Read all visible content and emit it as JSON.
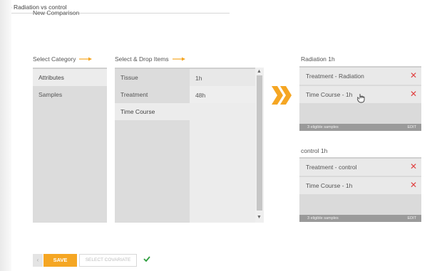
{
  "comparison": {
    "title": "New Comparison",
    "name_value": "1h - Radiation vs control"
  },
  "category": {
    "label": "Select Category",
    "items": [
      "Attributes",
      "Samples"
    ]
  },
  "items": {
    "label": "Select & Drop Items",
    "list": [
      "Tissue",
      "Treatment",
      "Time Course"
    ],
    "values": [
      "1h",
      "48h"
    ]
  },
  "groups": [
    {
      "title": "Radiation 1h",
      "rows": [
        "Treatment - Radiation",
        "Time Course - 1h"
      ],
      "footer": "3 eligible samples",
      "edit": "EDIT"
    },
    {
      "title": "control 1h",
      "rows": [
        "Treatment - control",
        "Time Course - 1h"
      ],
      "footer": "3 eligible samples",
      "edit": "EDIT"
    }
  ],
  "actions": {
    "back": "‹",
    "save": "SAVE",
    "select_covariate": "SELECT COVARIATE"
  },
  "colors": {
    "accent": "#f5a623",
    "remove": "#e04040",
    "success": "#2e9e3e"
  }
}
